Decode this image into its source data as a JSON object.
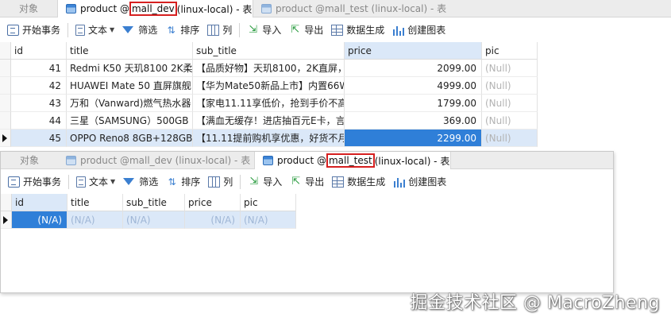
{
  "window1": {
    "tabs": [
      {
        "label": "对象"
      },
      {
        "prefix": "product @",
        "highlight": "mall_dev",
        "suffix": " (linux-local) - 表"
      },
      {
        "prefix": "product @mall_test (linux-local) - 表"
      }
    ],
    "grid": {
      "columns": [
        "id",
        "title",
        "sub_title",
        "price",
        "pic"
      ],
      "rows": [
        {
          "id": "41",
          "title": "Redmi K50 天玑8100 2K柔",
          "sub_title": "【品质好物】天玑8100，2K直屏，",
          "price": "2099.00",
          "pic": "(Null)"
        },
        {
          "id": "42",
          "title": "HUAWEI Mate 50 直屏旗舰",
          "sub_title": "【华为Mate50新品上市】内置66W",
          "price": "4999.00",
          "pic": "(Null)"
        },
        {
          "id": "43",
          "title": "万和（Vanward)燃气热水器",
          "sub_title": "【家电11.11享低价，抢到手价不高",
          "price": "1799.00",
          "pic": "(Null)"
        },
        {
          "id": "44",
          "title": "三星（SAMSUNG）500GB",
          "sub_title": "【满血无缓存！进店抽百元E卡，言",
          "price": "369.00",
          "pic": "(Null)"
        },
        {
          "id": "45",
          "title": "OPPO Reno8 8GB+128GB",
          "sub_title": "【11.11提前购机享优惠，好货不月",
          "price": "2299.00",
          "pic": "(Null)"
        }
      ]
    }
  },
  "toolbar": {
    "begin_transaction": "开始事务",
    "text": "文本",
    "filter": "筛选",
    "sort": "排序",
    "columns": "列",
    "import": "导入",
    "export": "导出",
    "data_generation": "数据生成",
    "create_chart": "创建图表"
  },
  "window2": {
    "tabs": [
      {
        "label": "对象"
      },
      {
        "prefix": "product @mall_dev (linux-local) - 表"
      },
      {
        "prefix": "product @",
        "highlight": "mall_test",
        "suffix": " (linux-local) - 表"
      }
    ],
    "grid": {
      "columns": [
        "id",
        "title",
        "sub_title",
        "price",
        "pic"
      ],
      "rows": [
        {
          "id": "(N/A)",
          "title": "(N/A)",
          "sub_title": "(N/A)",
          "price": "(N/A)",
          "pic": "(N/A)"
        }
      ]
    }
  },
  "watermark": "掘金技术社区 @ MacroZheng"
}
